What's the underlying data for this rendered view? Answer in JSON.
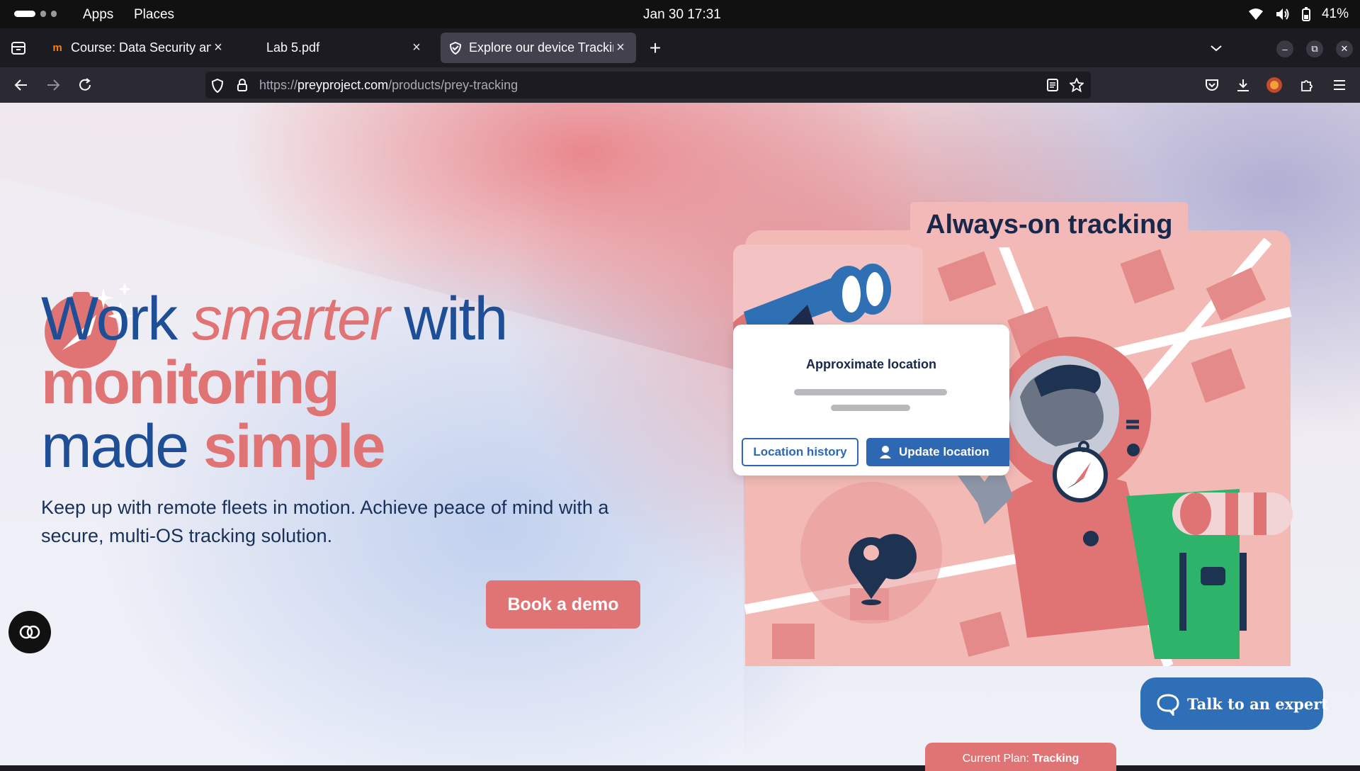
{
  "os_bar": {
    "menu_apps": "Apps",
    "menu_places": "Places",
    "clock": "Jan 30  17:31",
    "battery": "41%"
  },
  "tabs": [
    {
      "title": "Course: Data Security and",
      "icon": "moodle-icon",
      "active": false
    },
    {
      "title": "Lab 5.pdf",
      "icon": "",
      "active": false
    },
    {
      "title": "Explore our device Tracking",
      "icon": "prey-shield-icon",
      "active": true
    }
  ],
  "address_bar": {
    "url_prefix": "https://",
    "url_domain": "preyproject.com",
    "url_path": "/products/prey-tracking"
  },
  "hero": {
    "word_work": "Work ",
    "word_smarter": "smarter",
    "word_with": " with",
    "word_monitoring": "monitoring",
    "word_made": "made ",
    "word_simple": "simple",
    "subtitle": "Keep up with remote fleets in motion. Achieve peace of mind with a secure, multi-OS tracking solution.",
    "demo_button": "Book a demo"
  },
  "illustration": {
    "heading": "Always-on tracking",
    "card_title": "Approximate location",
    "history_button": "Location history",
    "update_button": "Update location",
    "plan_label": "Current Plan: ",
    "plan_value": "Tracking"
  },
  "chat": {
    "label": "Talk to an expert"
  },
  "colors": {
    "brand_blue": "#1e4e96",
    "brand_pink": "#e07475",
    "button_blue": "#2e67b2"
  }
}
